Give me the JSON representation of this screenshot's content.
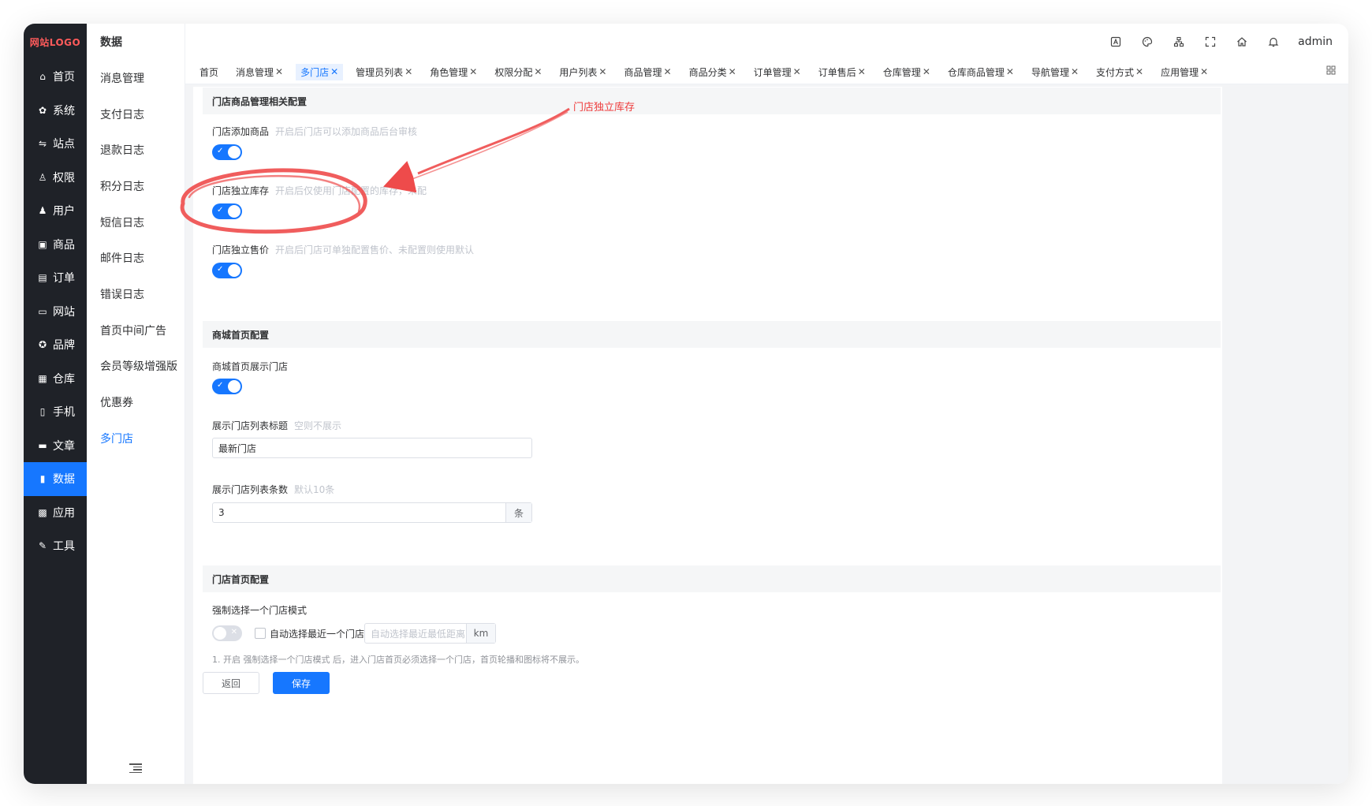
{
  "logo": "网站LOGO",
  "primary_nav": [
    {
      "label": "首页",
      "icon": "home-icon"
    },
    {
      "label": "系统",
      "icon": "gear-icon"
    },
    {
      "label": "站点",
      "icon": "sliders-icon"
    },
    {
      "label": "权限",
      "icon": "user-key-icon"
    },
    {
      "label": "用户",
      "icon": "user-icon"
    },
    {
      "label": "商品",
      "icon": "box-icon"
    },
    {
      "label": "订单",
      "icon": "clipboard-icon"
    },
    {
      "label": "网站",
      "icon": "monitor-icon"
    },
    {
      "label": "品牌",
      "icon": "badge-icon"
    },
    {
      "label": "仓库",
      "icon": "warehouse-icon"
    },
    {
      "label": "手机",
      "icon": "phone-icon"
    },
    {
      "label": "文章",
      "icon": "document-icon"
    },
    {
      "label": "数据",
      "icon": "bar-chart-icon",
      "active": true
    },
    {
      "label": "应用",
      "icon": "apps-icon"
    },
    {
      "label": "工具",
      "icon": "wrench-icon"
    }
  ],
  "secondary_nav": {
    "title": "数据",
    "items": [
      "消息管理",
      "支付日志",
      "退款日志",
      "积分日志",
      "短信日志",
      "邮件日志",
      "错误日志",
      "首页中间广告",
      "会员等级增强版",
      "优惠券",
      "多门店"
    ],
    "active": "多门店"
  },
  "header": {
    "user": "admin"
  },
  "tabs": [
    {
      "label": "首页",
      "closable": false
    },
    {
      "label": "消息管理",
      "closable": true
    },
    {
      "label": "多门店",
      "closable": true,
      "active": true
    },
    {
      "label": "管理员列表",
      "closable": true
    },
    {
      "label": "角色管理",
      "closable": true
    },
    {
      "label": "权限分配",
      "closable": true
    },
    {
      "label": "用户列表",
      "closable": true
    },
    {
      "label": "商品管理",
      "closable": true
    },
    {
      "label": "商品分类",
      "closable": true
    },
    {
      "label": "订单管理",
      "closable": true
    },
    {
      "label": "订单售后",
      "closable": true
    },
    {
      "label": "仓库管理",
      "closable": true
    },
    {
      "label": "仓库商品管理",
      "closable": true
    },
    {
      "label": "导航管理",
      "closable": true
    },
    {
      "label": "支付方式",
      "closable": true
    },
    {
      "label": "应用管理",
      "closable": true
    }
  ],
  "form": {
    "section1": {
      "title": "门店商品管理相关配置",
      "add_goods": {
        "label": "门店添加商品",
        "tip": "开启后门店可以添加商品后台审核",
        "enabled": true
      },
      "stock": {
        "label": "门店独立库存",
        "tip": "开启后仅使用门店配置的库存，未配",
        "enabled": true
      },
      "price": {
        "label": "门店独立售价",
        "tip": "开启后门店可单独配置售价、未配置则使用默认",
        "enabled": true
      }
    },
    "section2": {
      "title": "商城首页配置",
      "show_store": {
        "label": "商城首页展示门店",
        "enabled": true
      },
      "list_title": {
        "label": "展示门店列表标题",
        "tip": "空则不展示",
        "value": "最新门店"
      },
      "list_count": {
        "label": "展示门店列表条数",
        "tip": "默认10条",
        "value": "3",
        "suffix": "条"
      }
    },
    "section3": {
      "title": "门店首页配置",
      "force_select": {
        "label": "强制选择一个门店模式",
        "enabled": false
      },
      "auto_select_label": "自动选择最近一个门店",
      "distance_placeholder": "自动选择最近最低距离",
      "distance_unit": "km",
      "note": "1. 开启 强制选择一个门店模式 后，进入门店首页必须选择一个门店，首页轮播和图标将不展示。"
    },
    "back_label": "返回",
    "save_label": "保存"
  },
  "annotation": {
    "text": "门店独立库存",
    "color": "#ee3b3b"
  }
}
